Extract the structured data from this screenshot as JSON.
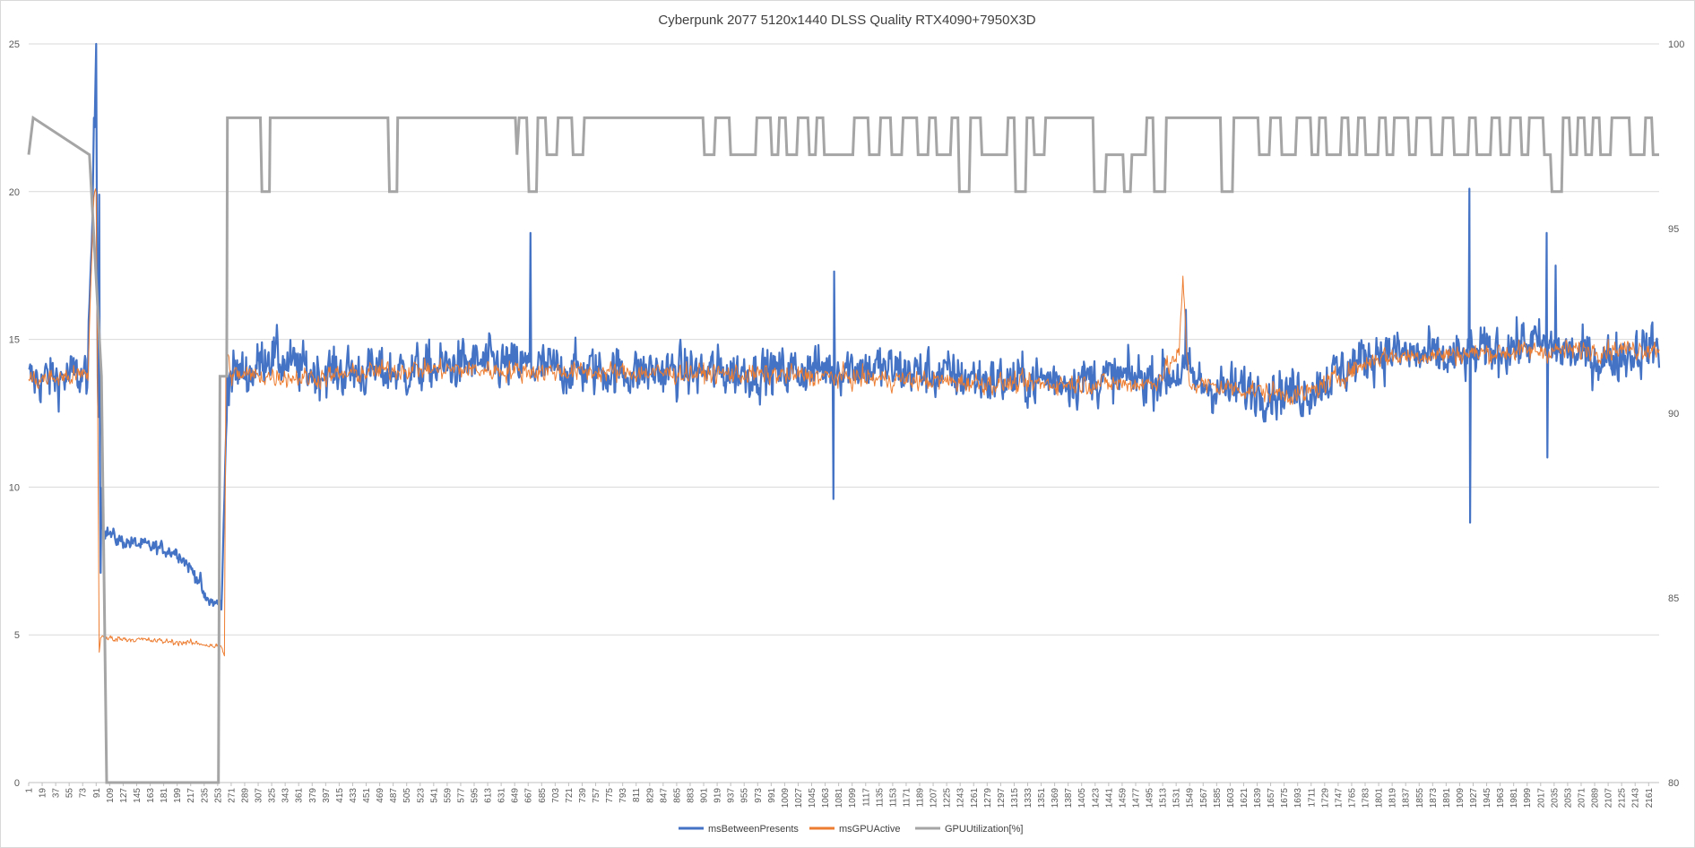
{
  "chart_data": {
    "type": "line",
    "title": "Cyberpunk 2077 5120x1440 DLSS Quality RTX4090+7950X3D",
    "xlabel": "",
    "ylabel": "",
    "y2label": "",
    "x_range": [
      1,
      2175
    ],
    "x_tick_start": 1,
    "x_tick_step": 18,
    "ylim": [
      0,
      25
    ],
    "y_ticks": [
      0,
      5,
      10,
      15,
      20,
      25
    ],
    "y2lim": [
      80,
      100
    ],
    "y2_ticks": [
      80,
      85,
      90,
      95,
      100
    ],
    "grid": true,
    "legend_position": "bottom",
    "series": [
      {
        "name": "msBetweenPresents",
        "axis": "left",
        "color": "#4472C4",
        "noise": 0.85,
        "points": [
          [
            1,
            13.6
          ],
          [
            80,
            13.8
          ],
          [
            88,
            21
          ],
          [
            91,
            25
          ],
          [
            93,
            14
          ],
          [
            97,
            11
          ],
          [
            100,
            8.6
          ],
          [
            120,
            8.2
          ],
          [
            160,
            8.0
          ],
          [
            200,
            7.8
          ],
          [
            230,
            6.8
          ],
          [
            235,
            6.2
          ],
          [
            258,
            6.0
          ],
          [
            262,
            9.5
          ],
          [
            266,
            13.8
          ],
          [
            300,
            13.9
          ],
          [
            320,
            14.6
          ],
          [
            340,
            14.2
          ],
          [
            380,
            13.9
          ],
          [
            500,
            13.9
          ],
          [
            600,
            14.2
          ],
          [
            700,
            14.0
          ],
          [
            800,
            13.9
          ],
          [
            1000,
            13.9
          ],
          [
            1100,
            14.1
          ],
          [
            1300,
            13.6
          ],
          [
            1500,
            13.7
          ],
          [
            1545,
            13.9
          ],
          [
            1560,
            13.5
          ],
          [
            1600,
            13.3
          ],
          [
            1700,
            13.2
          ],
          [
            1800,
            14.6
          ],
          [
            1900,
            14.3
          ],
          [
            2000,
            14.9
          ],
          [
            2100,
            14.3
          ],
          [
            2175,
            14.8
          ]
        ],
        "spikes": [
          [
            88,
            22.5
          ],
          [
            91,
            25
          ],
          [
            95,
            19.9
          ],
          [
            97,
            7.1
          ],
          [
            670,
            18.6
          ],
          [
            1074,
            9.6
          ],
          [
            1075,
            17.3
          ],
          [
            1544,
            16.0
          ],
          [
            1922,
            20.1
          ],
          [
            1923,
            8.8
          ],
          [
            2025,
            18.6
          ],
          [
            2026,
            11.0
          ],
          [
            2037,
            17.5
          ]
        ]
      },
      {
        "name": "msGPUActive",
        "axis": "left",
        "color": "#ED7D31",
        "noise": 0.35,
        "points": [
          [
            1,
            13.6
          ],
          [
            80,
            13.8
          ],
          [
            88,
            20
          ],
          [
            91,
            20
          ],
          [
            93,
            13
          ],
          [
            95,
            4.4
          ],
          [
            97,
            4.9
          ],
          [
            140,
            4.85
          ],
          [
            200,
            4.75
          ],
          [
            230,
            4.7
          ],
          [
            258,
            4.6
          ],
          [
            262,
            4.3
          ],
          [
            264,
            14.5
          ],
          [
            272,
            13.8
          ],
          [
            380,
            13.7
          ],
          [
            500,
            14.0
          ],
          [
            1000,
            13.8
          ],
          [
            1300,
            13.5
          ],
          [
            1500,
            13.5
          ],
          [
            1535,
            14.5
          ],
          [
            1540,
            17.0
          ],
          [
            1548,
            13.5
          ],
          [
            1700,
            13.1
          ],
          [
            1800,
            14.4
          ],
          [
            2000,
            14.6
          ],
          [
            2175,
            14.7
          ]
        ],
        "spikes": []
      },
      {
        "name": "GPUUtilization[%]",
        "axis": "right",
        "color": "#A5A5A5",
        "steps": [
          [
            1,
            97
          ],
          [
            7,
            98
          ],
          [
            82,
            97
          ],
          [
            98,
            91
          ],
          [
            105,
            80
          ],
          [
            254,
            80
          ],
          [
            256,
            91
          ],
          [
            265,
            91
          ],
          [
            266,
            98
          ],
          [
            310,
            98
          ],
          [
            312,
            96
          ],
          [
            322,
            96
          ],
          [
            323,
            98
          ],
          [
            480,
            98
          ],
          [
            482,
            96
          ],
          [
            492,
            96
          ],
          [
            493,
            98
          ],
          [
            650,
            98
          ],
          [
            652,
            97
          ],
          [
            655,
            98
          ],
          [
            665,
            98
          ],
          [
            668,
            96
          ],
          [
            678,
            96
          ],
          [
            680,
            98
          ],
          [
            690,
            98
          ],
          [
            692,
            97
          ],
          [
            705,
            97
          ],
          [
            707,
            98
          ],
          [
            725,
            98
          ],
          [
            727,
            97
          ],
          [
            740,
            97
          ],
          [
            742,
            98
          ],
          [
            900,
            98
          ],
          [
            902,
            97
          ],
          [
            915,
            97
          ],
          [
            917,
            98
          ],
          [
            935,
            98
          ],
          [
            937,
            97
          ],
          [
            970,
            97
          ],
          [
            972,
            98
          ],
          [
            990,
            98
          ],
          [
            992,
            97
          ],
          [
            1000,
            97
          ],
          [
            1002,
            98
          ],
          [
            1010,
            98
          ],
          [
            1012,
            97
          ],
          [
            1025,
            97
          ],
          [
            1027,
            98
          ],
          [
            1040,
            98
          ],
          [
            1042,
            97
          ],
          [
            1050,
            97
          ],
          [
            1052,
            98
          ],
          [
            1060,
            98
          ],
          [
            1062,
            97
          ],
          [
            1100,
            97
          ],
          [
            1102,
            98
          ],
          [
            1120,
            98
          ],
          [
            1122,
            97
          ],
          [
            1135,
            97
          ],
          [
            1137,
            98
          ],
          [
            1150,
            98
          ],
          [
            1152,
            97
          ],
          [
            1165,
            97
          ],
          [
            1167,
            98
          ],
          [
            1185,
            98
          ],
          [
            1187,
            97
          ],
          [
            1200,
            97
          ],
          [
            1202,
            98
          ],
          [
            1210,
            98
          ],
          [
            1212,
            97
          ],
          [
            1230,
            97
          ],
          [
            1232,
            98
          ],
          [
            1240,
            98
          ],
          [
            1242,
            96
          ],
          [
            1255,
            96
          ],
          [
            1257,
            98
          ],
          [
            1270,
            98
          ],
          [
            1272,
            97
          ],
          [
            1305,
            97
          ],
          [
            1307,
            98
          ],
          [
            1315,
            98
          ],
          [
            1317,
            96
          ],
          [
            1330,
            96
          ],
          [
            1332,
            98
          ],
          [
            1340,
            98
          ],
          [
            1342,
            97
          ],
          [
            1355,
            97
          ],
          [
            1357,
            98
          ],
          [
            1420,
            98
          ],
          [
            1422,
            96
          ],
          [
            1436,
            96
          ],
          [
            1438,
            97
          ],
          [
            1460,
            97
          ],
          [
            1462,
            96
          ],
          [
            1470,
            96
          ],
          [
            1472,
            97
          ],
          [
            1490,
            97
          ],
          [
            1492,
            98
          ],
          [
            1500,
            98
          ],
          [
            1502,
            96
          ],
          [
            1516,
            96
          ],
          [
            1518,
            98
          ],
          [
            1590,
            98
          ],
          [
            1592,
            96
          ],
          [
            1606,
            96
          ],
          [
            1608,
            98
          ],
          [
            1640,
            98
          ],
          [
            1642,
            97
          ],
          [
            1655,
            97
          ],
          [
            1657,
            98
          ],
          [
            1670,
            98
          ],
          [
            1672,
            97
          ],
          [
            1690,
            97
          ],
          [
            1692,
            98
          ],
          [
            1710,
            98
          ],
          [
            1712,
            97
          ],
          [
            1720,
            97
          ],
          [
            1722,
            98
          ],
          [
            1730,
            98
          ],
          [
            1732,
            97
          ],
          [
            1750,
            97
          ],
          [
            1752,
            98
          ],
          [
            1760,
            98
          ],
          [
            1762,
            97
          ],
          [
            1772,
            97
          ],
          [
            1774,
            98
          ],
          [
            1782,
            98
          ],
          [
            1784,
            97
          ],
          [
            1800,
            97
          ],
          [
            1802,
            98
          ],
          [
            1810,
            98
          ],
          [
            1812,
            97
          ],
          [
            1820,
            97
          ],
          [
            1822,
            98
          ],
          [
            1840,
            98
          ],
          [
            1842,
            97
          ],
          [
            1850,
            97
          ],
          [
            1852,
            98
          ],
          [
            1870,
            98
          ],
          [
            1872,
            97
          ],
          [
            1885,
            97
          ],
          [
            1887,
            98
          ],
          [
            1900,
            98
          ],
          [
            1902,
            97
          ],
          [
            1920,
            97
          ],
          [
            1922,
            98
          ],
          [
            1930,
            98
          ],
          [
            1932,
            97
          ],
          [
            1950,
            97
          ],
          [
            1952,
            98
          ],
          [
            1962,
            98
          ],
          [
            1964,
            97
          ],
          [
            1975,
            97
          ],
          [
            1977,
            98
          ],
          [
            1990,
            98
          ],
          [
            1992,
            97
          ],
          [
            2000,
            97
          ],
          [
            2002,
            98
          ],
          [
            2020,
            98
          ],
          [
            2022,
            97
          ],
          [
            2030,
            97
          ],
          [
            2032,
            96
          ],
          [
            2045,
            96
          ],
          [
            2047,
            98
          ],
          [
            2055,
            98
          ],
          [
            2057,
            97
          ],
          [
            2065,
            97
          ],
          [
            2067,
            98
          ],
          [
            2075,
            98
          ],
          [
            2077,
            97
          ],
          [
            2085,
            97
          ],
          [
            2087,
            98
          ],
          [
            2095,
            98
          ],
          [
            2097,
            97
          ],
          [
            2110,
            97
          ],
          [
            2112,
            98
          ],
          [
            2135,
            98
          ],
          [
            2137,
            97
          ],
          [
            2155,
            97
          ],
          [
            2157,
            98
          ],
          [
            2165,
            98
          ],
          [
            2167,
            97
          ],
          [
            2175,
            97
          ]
        ]
      }
    ]
  }
}
